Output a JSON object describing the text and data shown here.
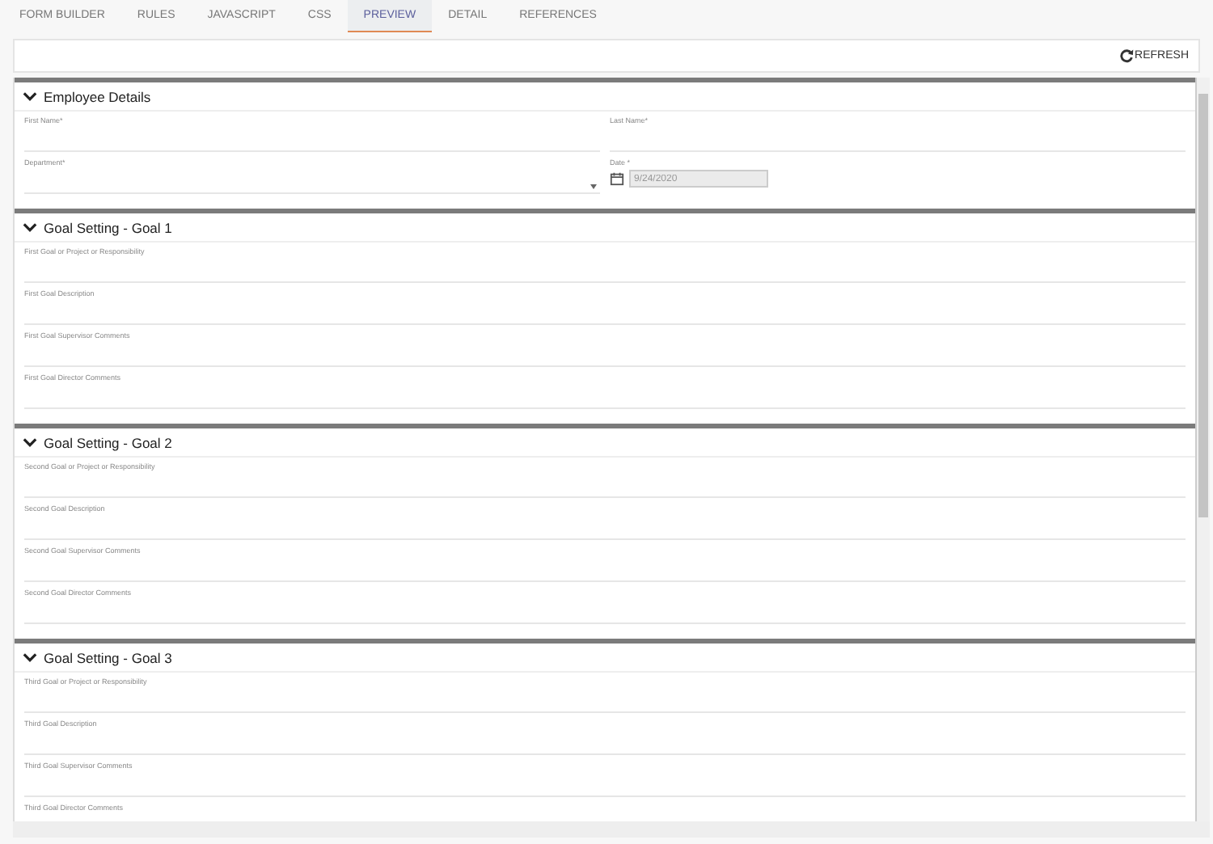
{
  "tabs": [
    {
      "label": "FORM BUILDER",
      "selected": false
    },
    {
      "label": "RULES",
      "selected": false
    },
    {
      "label": "JAVASCRIPT",
      "selected": false
    },
    {
      "label": "CSS",
      "selected": false
    },
    {
      "label": "PREVIEW",
      "selected": true
    },
    {
      "label": "DETAIL",
      "selected": false
    },
    {
      "label": "REFERENCES",
      "selected": false
    }
  ],
  "toolbar": {
    "refresh_button": "REFRESH"
  },
  "sections": [
    {
      "title": "Employee Details",
      "expanded": true,
      "kind": "two_column",
      "fields": [
        {
          "label": "First Name*",
          "kind": "text"
        },
        {
          "label": "Last Name*",
          "kind": "text"
        },
        {
          "label": "Department*",
          "kind": "select"
        },
        {
          "label": "Date *",
          "kind": "date",
          "value": "9/24/2020",
          "disabled": true
        }
      ]
    },
    {
      "title": "Goal Setting - Goal 1",
      "expanded": true,
      "kind": "single",
      "fields": [
        {
          "label": "First Goal or Project or Responsibility",
          "kind": "text"
        },
        {
          "label": "First Goal Description",
          "kind": "text"
        },
        {
          "label": "First Goal Supervisor Comments",
          "kind": "text"
        },
        {
          "label": "First Goal Director Comments",
          "kind": "text"
        }
      ]
    },
    {
      "title": "Goal Setting - Goal 2",
      "expanded": true,
      "kind": "single",
      "fields": [
        {
          "label": "Second Goal or Project or Responsibility",
          "kind": "text"
        },
        {
          "label": "Second Goal Description",
          "kind": "text"
        },
        {
          "label": "Second Goal Supervisor Comments",
          "kind": "text"
        },
        {
          "label": "Second Goal Director Comments",
          "kind": "text"
        }
      ]
    },
    {
      "title": "Goal Setting - Goal 3",
      "expanded": true,
      "kind": "single",
      "fields": [
        {
          "label": "Third Goal or Project or Responsibility",
          "kind": "text"
        },
        {
          "label": "Third Goal Description",
          "kind": "text"
        },
        {
          "label": "Third Goal Supervisor Comments",
          "kind": "text"
        },
        {
          "label": "Third Goal Director Comments",
          "kind": "label_only"
        }
      ]
    }
  ]
}
